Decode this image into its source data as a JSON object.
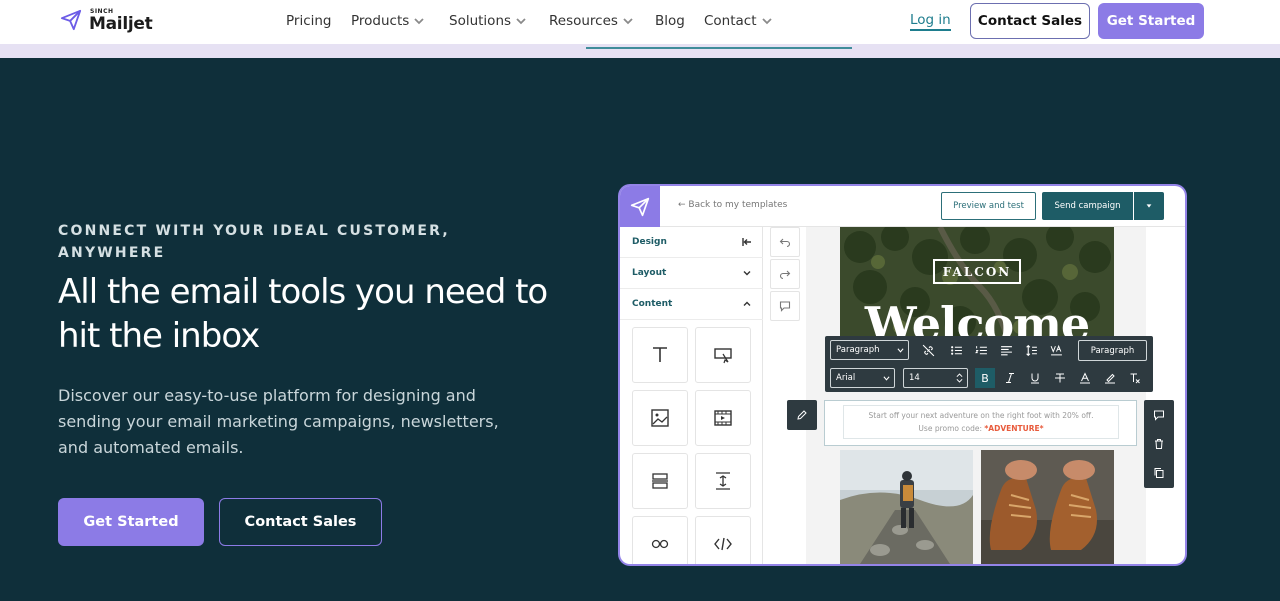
{
  "nav": {
    "logo_small": "SINCH",
    "logo_word": "Mailjet",
    "items": [
      {
        "label": "Pricing",
        "dropdown": false
      },
      {
        "label": "Products",
        "dropdown": true
      },
      {
        "label": "Solutions",
        "dropdown": true
      },
      {
        "label": "Resources",
        "dropdown": true
      },
      {
        "label": "Blog",
        "dropdown": false
      },
      {
        "label": "Contact",
        "dropdown": true
      }
    ],
    "login": "Log in",
    "contact_sales": "Contact Sales",
    "get_started": "Get Started"
  },
  "hero": {
    "eyebrow": "CONNECT WITH YOUR IDEAL CUSTOMER, ANYWHERE",
    "headline": "All the email tools you need to hit the inbox",
    "description": "Discover our easy-to-use platform for designing and sending your email marketing campaigns, newsletters, and automated emails.",
    "cta_primary": "Get Started",
    "cta_secondary": "Contact Sales"
  },
  "editor": {
    "back_link": "Back to my templates",
    "preview_button": "Preview and test",
    "send_button": "Send campaign",
    "sidebar": {
      "design": "Design",
      "layout": "Layout",
      "content": "Content"
    },
    "tiles": [
      "text-icon",
      "button-icon",
      "image-icon",
      "video-icon",
      "divider-icon",
      "spacer-icon",
      "social-icon",
      "code-icon"
    ],
    "canvas": {
      "brand": "FALCON",
      "welcome": "Welcome",
      "text_line1": "Start off your next adventure on the right foot with 20% off.",
      "text_line2_prefix": "Use promo code: ",
      "promo_code": "*ADVENTURE*"
    },
    "toolbar": {
      "block_type": "Paragraph",
      "font": "Arial",
      "size": "14",
      "style_button": "Paragraph",
      "bold": "B"
    }
  },
  "colors": {
    "background": "#0f2f3a",
    "accent": "#8c7be6",
    "teal": "#1e5c66"
  }
}
